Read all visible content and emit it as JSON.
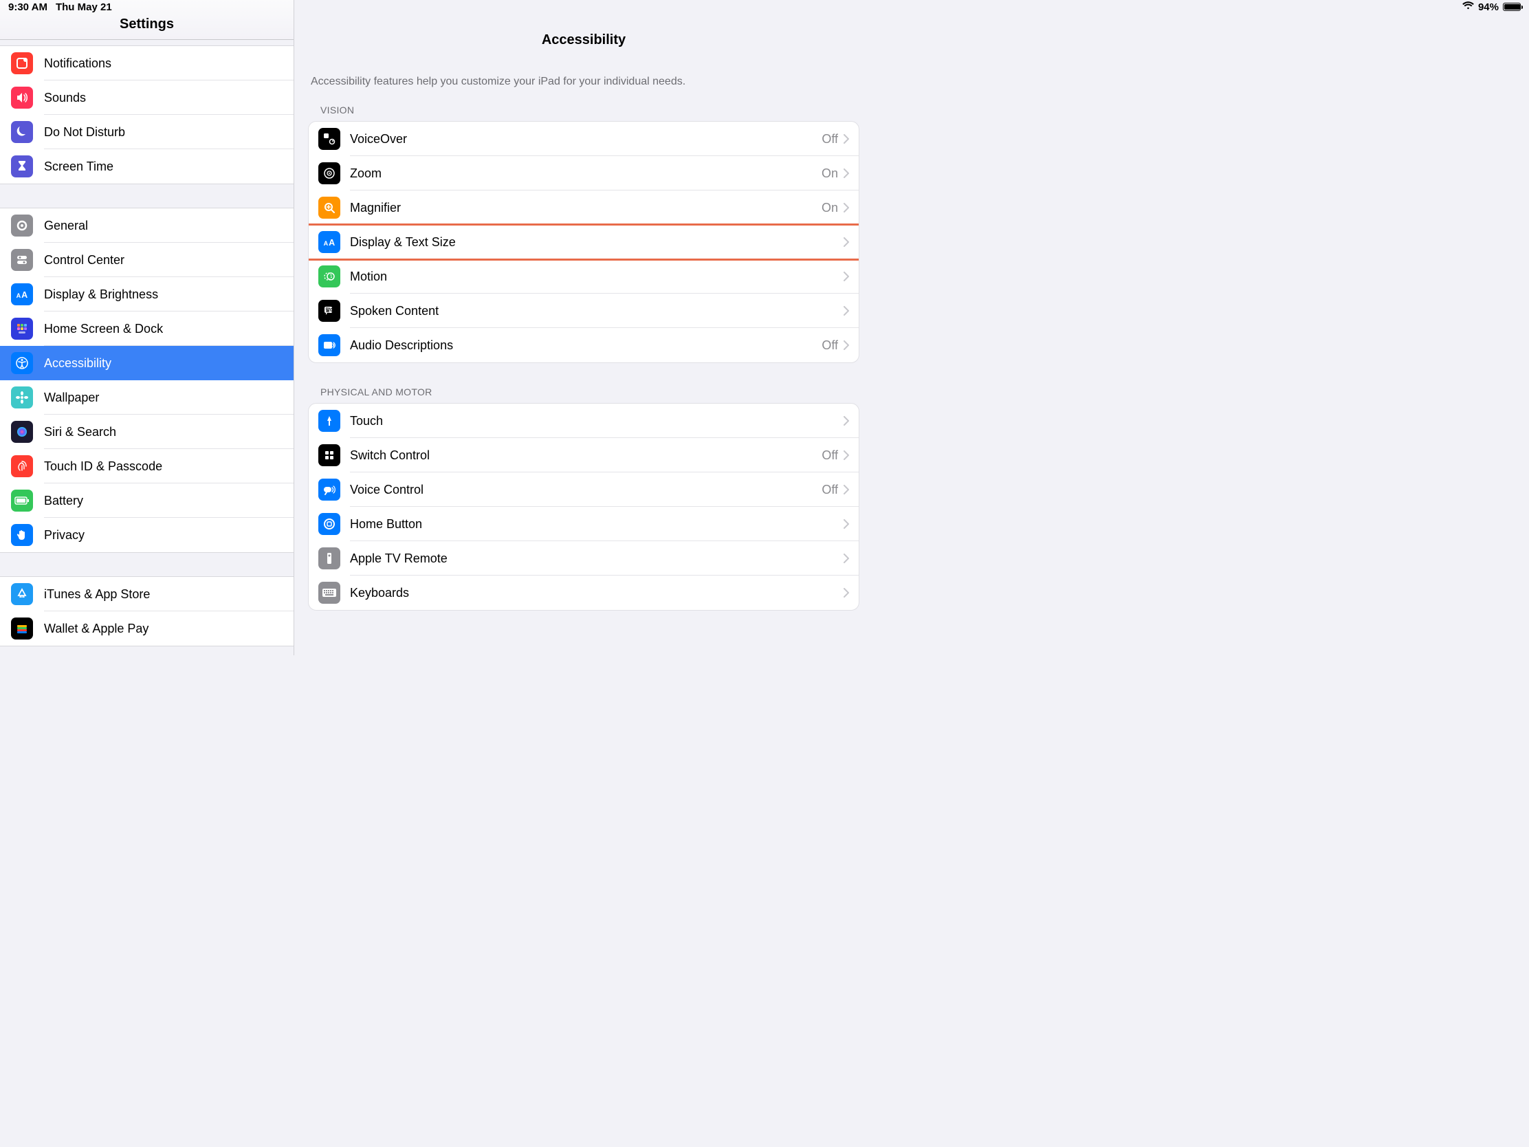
{
  "statusbar": {
    "time": "9:30 AM",
    "date": "Thu May 21",
    "battery_pct": "94%"
  },
  "sidebar": {
    "title": "Settings",
    "groups": [
      {
        "items": [
          {
            "id": "notifications",
            "label": "Notifications",
            "iconColor": "#ff3b30",
            "icon": "notif"
          },
          {
            "id": "sounds",
            "label": "Sounds",
            "iconColor": "#ff3257",
            "icon": "sound"
          },
          {
            "id": "dnd",
            "label": "Do Not Disturb",
            "iconColor": "#5856d6",
            "icon": "moon"
          },
          {
            "id": "screentime",
            "label": "Screen Time",
            "iconColor": "#5856d6",
            "icon": "hourglass"
          }
        ]
      },
      {
        "items": [
          {
            "id": "general",
            "label": "General",
            "iconColor": "#8e8e93",
            "icon": "gear"
          },
          {
            "id": "controlcenter",
            "label": "Control Center",
            "iconColor": "#8e8e93",
            "icon": "toggles"
          },
          {
            "id": "display",
            "label": "Display & Brightness",
            "iconColor": "#007aff",
            "icon": "aa"
          },
          {
            "id": "homescreen",
            "label": "Home Screen & Dock",
            "iconColor": "#2f3cdd",
            "icon": "grid"
          },
          {
            "id": "accessibility",
            "label": "Accessibility",
            "iconColor": "#007aff",
            "icon": "access",
            "selected": true
          },
          {
            "id": "wallpaper",
            "label": "Wallpaper",
            "iconColor": "#3fc8c8",
            "icon": "flower"
          },
          {
            "id": "siri",
            "label": "Siri & Search",
            "iconColor": "#1b1930",
            "icon": "siri"
          },
          {
            "id": "touchid",
            "label": "Touch ID & Passcode",
            "iconColor": "#ff3b30",
            "icon": "finger"
          },
          {
            "id": "battery",
            "label": "Battery",
            "iconColor": "#34c759",
            "icon": "batt"
          },
          {
            "id": "privacy",
            "label": "Privacy",
            "iconColor": "#007aff",
            "icon": "hand"
          }
        ]
      },
      {
        "items": [
          {
            "id": "itunes",
            "label": "iTunes & App Store",
            "iconColor": "#1e9bf5",
            "icon": "appstore"
          },
          {
            "id": "wallet",
            "label": "Wallet & Apple Pay",
            "iconColor": "#000",
            "icon": "wallet"
          }
        ]
      }
    ]
  },
  "content": {
    "title": "Accessibility",
    "caption": "Accessibility features help you customize your iPad for your individual needs.",
    "sections": [
      {
        "label": "VISION",
        "rows": [
          {
            "id": "voiceover",
            "label": "VoiceOver",
            "value": "Off",
            "iconColor": "#000",
            "icon": "vo"
          },
          {
            "id": "zoom",
            "label": "Zoom",
            "value": "On",
            "iconColor": "#000",
            "icon": "zoom"
          },
          {
            "id": "magnifier",
            "label": "Magnifier",
            "value": "On",
            "iconColor": "#ff9500",
            "icon": "mag"
          },
          {
            "id": "displaytext",
            "label": "Display & Text Size",
            "value": "",
            "iconColor": "#007aff",
            "icon": "aa",
            "highlighted": true
          },
          {
            "id": "motion",
            "label": "Motion",
            "value": "",
            "iconColor": "#34c759",
            "icon": "motion"
          },
          {
            "id": "spoken",
            "label": "Spoken Content",
            "value": "",
            "iconColor": "#000",
            "icon": "spoken"
          },
          {
            "id": "audiodesc",
            "label": "Audio Descriptions",
            "value": "Off",
            "iconColor": "#007aff",
            "icon": "ad"
          }
        ]
      },
      {
        "label": "PHYSICAL AND MOTOR",
        "rows": [
          {
            "id": "touch",
            "label": "Touch",
            "value": "",
            "iconColor": "#007aff",
            "icon": "touch"
          },
          {
            "id": "switchcontrol",
            "label": "Switch Control",
            "value": "Off",
            "iconColor": "#000",
            "icon": "switch"
          },
          {
            "id": "voicecontrol",
            "label": "Voice Control",
            "value": "Off",
            "iconColor": "#007aff",
            "icon": "voice"
          },
          {
            "id": "homebutton",
            "label": "Home Button",
            "value": "",
            "iconColor": "#007aff",
            "icon": "home"
          },
          {
            "id": "appletv",
            "label": "Apple TV Remote",
            "value": "",
            "iconColor": "#8e8e93",
            "icon": "remote"
          },
          {
            "id": "keyboards",
            "label": "Keyboards",
            "value": "",
            "iconColor": "#8e8e93",
            "icon": "keyboard"
          }
        ]
      }
    ]
  }
}
